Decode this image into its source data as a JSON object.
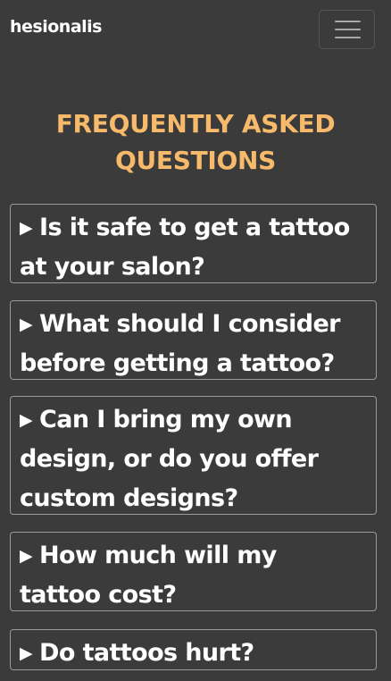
{
  "navbar": {
    "brand": "hesionalis",
    "toggler_icon": "hamburger-menu-icon"
  },
  "faq": {
    "title": "FREQUENTLY ASKED\nQUESTIONS",
    "arrow_icon": "caret-right-icon",
    "arrow_glyph": "▶",
    "items": [
      {
        "question": "Is it safe to get a tattoo\nat your salon?"
      },
      {
        "question": "What should I consider\nbefore getting a tattoo?"
      },
      {
        "question": "Can I bring my own\ndesign, or do you offer\ncustom designs?"
      },
      {
        "question": "How much will my\ntattoo cost?"
      },
      {
        "question": "Do tattoos hurt?"
      }
    ]
  },
  "colors": {
    "background": "#3b3b3b",
    "title_accent": "#f7b96a",
    "text": "#ffffff",
    "border": "#9a9a9a"
  }
}
